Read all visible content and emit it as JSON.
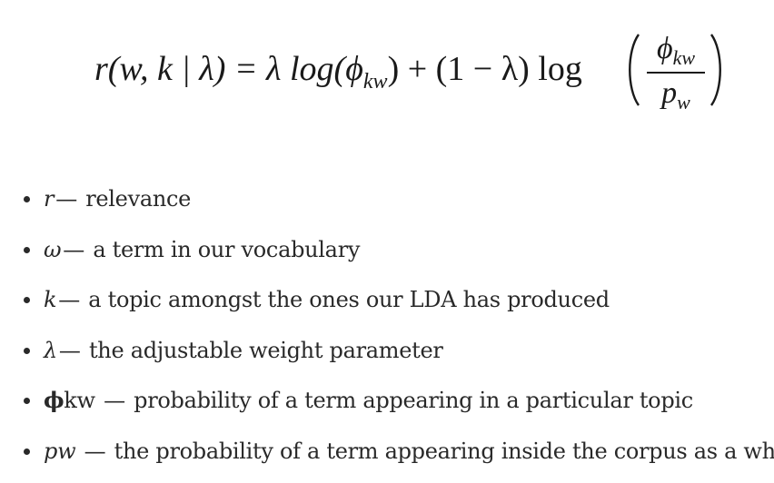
{
  "formula": {
    "lhs": "r(w, k | λ) = λ log(",
    "phi": "ϕ",
    "phi_sub": "kw",
    "mid": ") + (1 − λ) log",
    "fraction": {
      "numerator": "ϕ",
      "numerator_sub": "kw",
      "denominator": "p",
      "denominator_sub": "w"
    }
  },
  "definitions": [
    {
      "symbol": "r",
      "dash": "—",
      "text": " relevance"
    },
    {
      "symbol": "ω",
      "dash": "—",
      "text": " a term in our vocabulary"
    },
    {
      "symbol": "k",
      "dash": "—",
      "text": " a topic amongst the ones our LDA has produced"
    },
    {
      "symbol": "λ",
      "dash": "—",
      "text": " the adjustable weight parameter"
    },
    {
      "symbol": "ϕ",
      "symbol_suffix": "kw",
      "dash": " —",
      "text": " probability of a term appearing in a particular topic"
    },
    {
      "symbol": "pw",
      "dash": " —",
      "text": " the probability of a term appearing inside the corpus as a whole"
    }
  ]
}
